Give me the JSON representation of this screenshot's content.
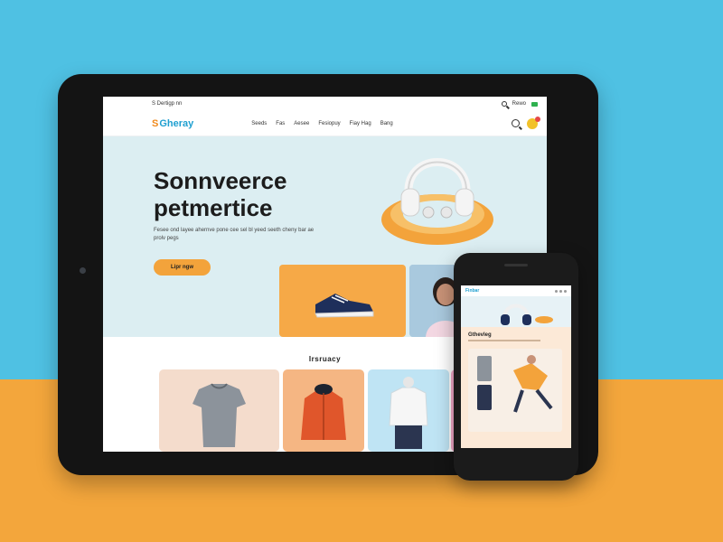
{
  "tablet": {
    "utility": {
      "left_text": "S Dertigp nn",
      "right_text": "Rewo"
    },
    "nav": {
      "logo": "Gheray",
      "links": [
        "Seeds",
        "Fas",
        "Aesee",
        "Fesiopuy",
        "Fiay Hag",
        "Bang"
      ]
    },
    "hero": {
      "title": "Sonnveerce petmertice",
      "subtitle": "Fesee ond layee ahernve pone cee sel bl yeed seeth cheny bar ae prolv pegs",
      "button_label": "Lipr ngw"
    },
    "section_title": "Irsruacy",
    "products": [
      {
        "name": "gray-tshirt"
      },
      {
        "name": "orange-jacket"
      },
      {
        "name": "white-shirt"
      },
      {
        "name": "pink-item"
      }
    ]
  },
  "phone": {
    "nav_logo": "Finbar",
    "section_title": "Gthevleg"
  },
  "colors": {
    "sky": "#4fc1e3",
    "orange": "#f3a63c",
    "accent_blue": "#1e9fd0",
    "button_orange": "#f3a33b"
  }
}
